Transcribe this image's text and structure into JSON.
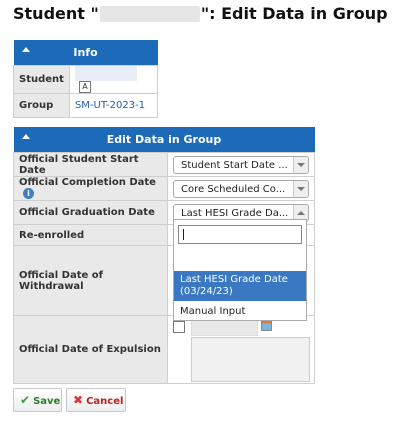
{
  "page": {
    "title_prefix": "Student \"",
    "title_suffix": "\": Edit Data in Group"
  },
  "info": {
    "header": "Info",
    "student_label": "Student",
    "sort_icon": "A",
    "group_label": "Group",
    "group_value": "SM-UT-2023-1"
  },
  "edit": {
    "header": "Edit Data in Group",
    "rows": {
      "start_label": "Official Student Start Date",
      "start_value": "Student Start Date ...",
      "completion_label": "Official Completion Date",
      "completion_value": "Core Scheduled Co...",
      "info_icon": "i",
      "graduation_label": "Official Graduation Date",
      "graduation_value": "Last HESI Grade Da...",
      "reenrolled_label": "Re-enrolled",
      "withdrawal_label": "Official Date of Withdrawal",
      "expulsion_label": "Official Date of Expulsion"
    },
    "dropdown": {
      "options": [
        "Last HESI Grade Date (03/24/23)",
        "Manual Input"
      ],
      "highlighted": "Last HESI Grade Date (03/24/23)"
    }
  },
  "buttons": {
    "save": "Save",
    "cancel": "Cancel",
    "save_icon": "check-icon",
    "cancel_icon": "x-icon"
  },
  "colors": {
    "header_blue": "#1d6bb8",
    "highlight_blue": "#3a78c3"
  }
}
